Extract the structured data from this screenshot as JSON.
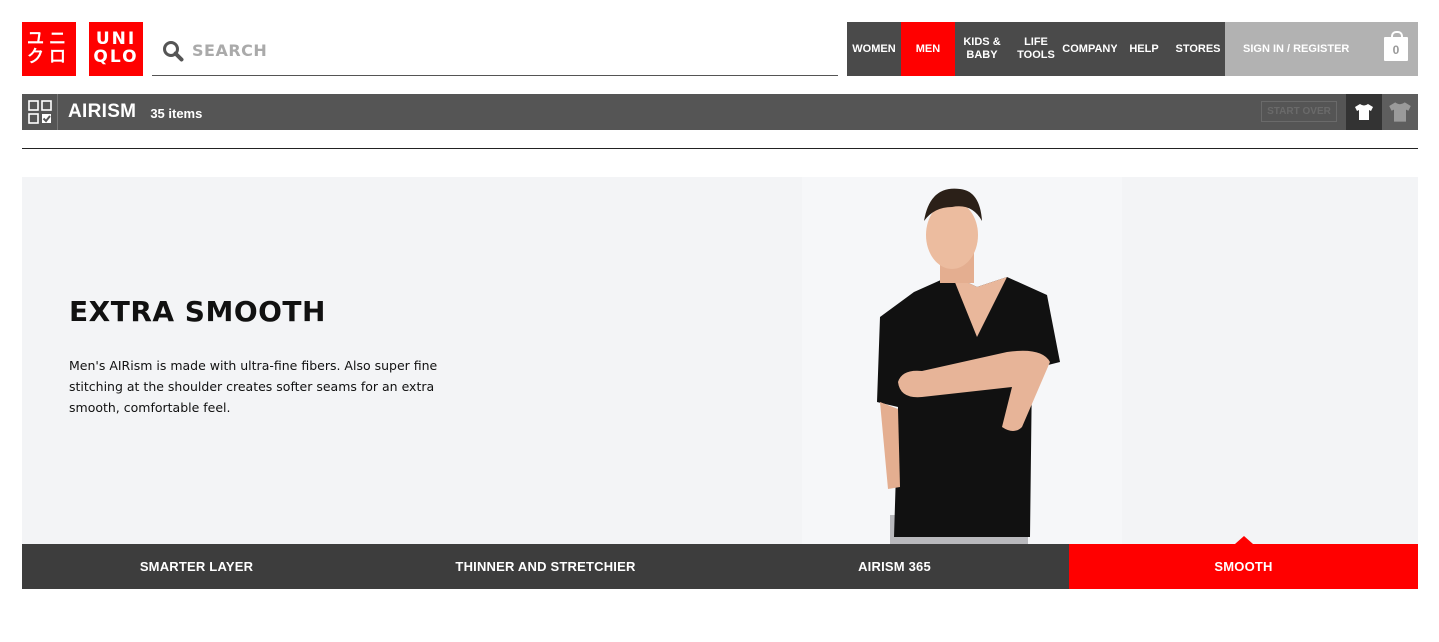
{
  "brand": {
    "logo_kana": [
      "ユニ",
      "クロ"
    ],
    "logo_latin": [
      "UNI",
      "QLO"
    ],
    "color": "#ff0000"
  },
  "search": {
    "placeholder": "SEARCH",
    "icon": "search-icon"
  },
  "topnav": {
    "items": [
      {
        "label": "WOMEN",
        "active": false
      },
      {
        "label": "MEN",
        "active": true
      },
      {
        "label": "KIDS &\nBABY",
        "active": false
      },
      {
        "label": "LIFE\nTOOLS",
        "active": false
      },
      {
        "label": "COMPANY",
        "active": false
      },
      {
        "label": "HELP",
        "active": false
      },
      {
        "label": "STORES",
        "active": false
      }
    ],
    "signin_label": "SIGN IN / REGISTER",
    "cart_count": "0"
  },
  "category": {
    "title": "AIRISM",
    "count": "35 items",
    "start_over": "START OVER"
  },
  "hero": {
    "title": "EXTRA SMOOTH",
    "description": "Men's AIRism is made with ultra-fine fibers. Also super fine stitching at the shoulder creates softer seams for an extra smooth, comfortable feel."
  },
  "tabs": [
    {
      "label": "SMARTER LAYER",
      "active": false
    },
    {
      "label": "THINNER AND STRETCHIER",
      "active": false
    },
    {
      "label": "AIRISM 365",
      "active": false
    },
    {
      "label": "SMOOTH",
      "active": true
    }
  ],
  "colors": {
    "accent": "#ff0000",
    "nav_bg": "#4a4a4a",
    "catbar_bg": "#555555",
    "tabs_bg": "#3d3d3d",
    "hero_bg": "#f3f4f6"
  }
}
